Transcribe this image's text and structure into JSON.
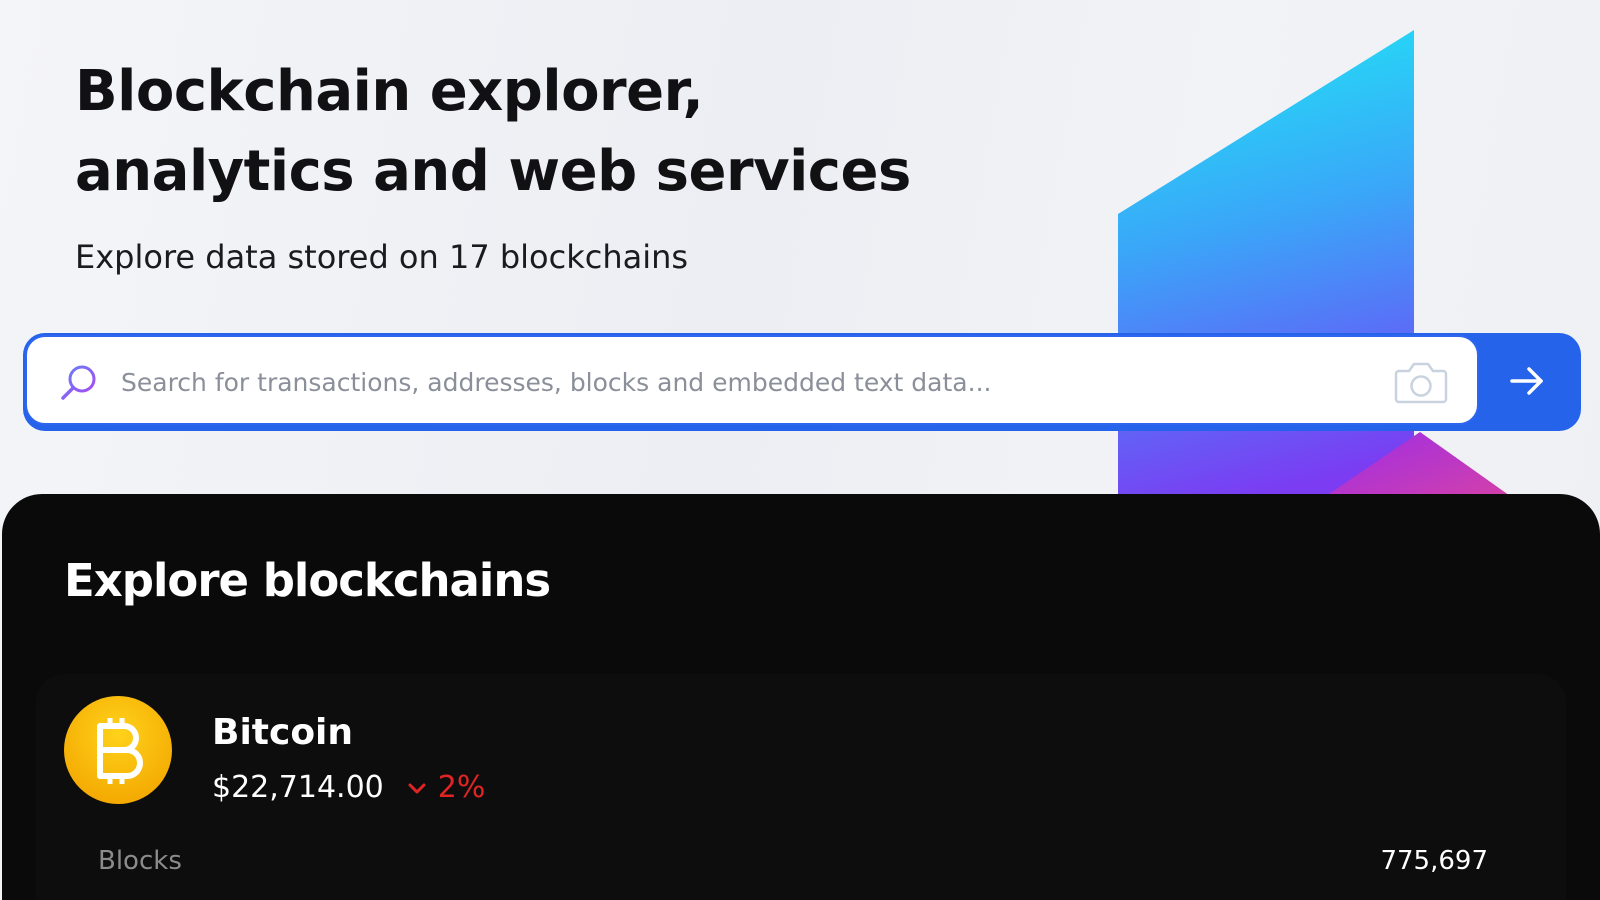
{
  "hero": {
    "title_line1": "Blockchain explorer,",
    "title_line2": "analytics and web services",
    "subtitle": "Explore data stored on 17 blockchains"
  },
  "search": {
    "placeholder": "Search for transactions, addresses, blocks and embedded text data...",
    "value": "",
    "search_icon": "search-icon",
    "camera_icon": "camera-icon",
    "submit_icon": "arrow-right-icon"
  },
  "explore": {
    "title": "Explore blockchains",
    "chains": [
      {
        "name": "Bitcoin",
        "price": "$22,714.00",
        "change": "2%",
        "change_direction": "down",
        "icon": "bitcoin-icon",
        "stats": [
          {
            "label": "Blocks",
            "value": "775,697"
          }
        ]
      }
    ]
  },
  "colors": {
    "accent": "#2563eb",
    "panel_background": "#0a0a0a",
    "bitcoin": "#f7b500",
    "negative": "#e02424",
    "text_dark": "#111114"
  }
}
